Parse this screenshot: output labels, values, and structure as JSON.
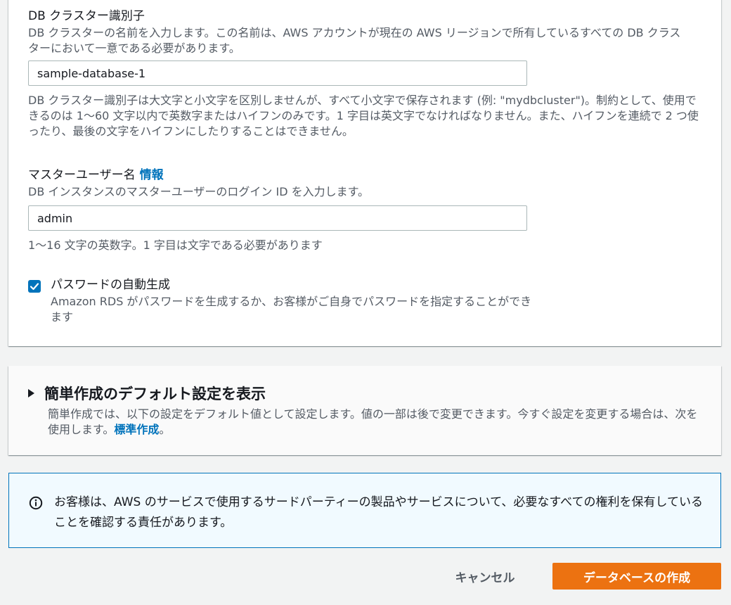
{
  "cluster_identifier": {
    "label": "DB クラスター識別子",
    "description": "DB クラスターの名前を入力します。この名前は、AWS アカウントが現在の AWS リージョンで所有しているすべての DB クラスターにおいて一意である必要があります。",
    "value": "sample-database-1",
    "constraint": "DB クラスター識別子は大文字と小文字を区別しませんが、すべて小文字で保存されます (例: \"mydbcluster\")。制約として、使用できるのは 1〜60 文字以内で英数字またはハイフンのみです。1 字目は英文字でなければなりません。また、ハイフンを連続で 2 つ使ったり、最後の文字をハイフンにしたりすることはできません。"
  },
  "master_username": {
    "label": "マスターユーザー名",
    "info_link": "情報",
    "description": "DB インスタンスのマスターユーザーのログイン ID を入力します。",
    "value": "admin",
    "constraint": "1〜16 文字の英数字。1 字目は文字である必要があります"
  },
  "auto_password": {
    "checked": true,
    "label": "パスワードの自動生成",
    "description": "Amazon RDS がパスワードを生成するか、お客様がご自身でパスワードを指定することができます"
  },
  "easy_create_defaults": {
    "title": "簡単作成のデフォルト設定を表示",
    "description": "簡単作成では、以下の設定をデフォルト値として設定します。値の一部は後で変更できます。今すぐ設定を変更する場合は、次を使用します。",
    "link": "標準作成",
    "suffix": "。"
  },
  "notice": {
    "text": "お客様は、AWS のサービスで使用するサードパーティーの製品やサービスについて、必要なすべての権利を保有していることを確認する責任があります。"
  },
  "actions": {
    "cancel_label": "キャンセル",
    "create_label": "データベースの作成"
  },
  "colors": {
    "primary_button": "#ec7211",
    "link": "#0073bb",
    "checkbox": "#0073bb",
    "info_border": "#0073bb",
    "info_background": "#f1faff"
  }
}
